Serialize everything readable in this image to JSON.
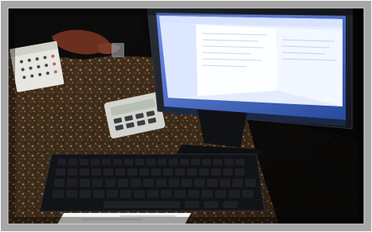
{
  "scene": {
    "kind": "photo",
    "colors": {
      "frame": "#ffffff",
      "background_dark": "#0b0a0b",
      "granite_base": "#4a3420",
      "granite_light": "#a88a5b",
      "monitor_bezel": "#1d1f25",
      "screen_blue": "#3b63c6",
      "window_bg": "#eef3ff",
      "keyboard": "#121317",
      "calculator": "#d3d3cd",
      "calendar": "#e7e7e1",
      "paper": "#f4f4f2"
    },
    "objects": [
      {
        "name": "monitor",
        "icon": "computer-monitor-icon"
      },
      {
        "name": "keyboard",
        "icon": "keyboard-icon"
      },
      {
        "name": "calculator",
        "icon": "calculator-icon"
      },
      {
        "name": "calendar",
        "icon": "calendar-icon"
      },
      {
        "name": "papers",
        "icon": "document-icon"
      },
      {
        "name": "hand",
        "icon": "hand-icon"
      }
    ]
  }
}
